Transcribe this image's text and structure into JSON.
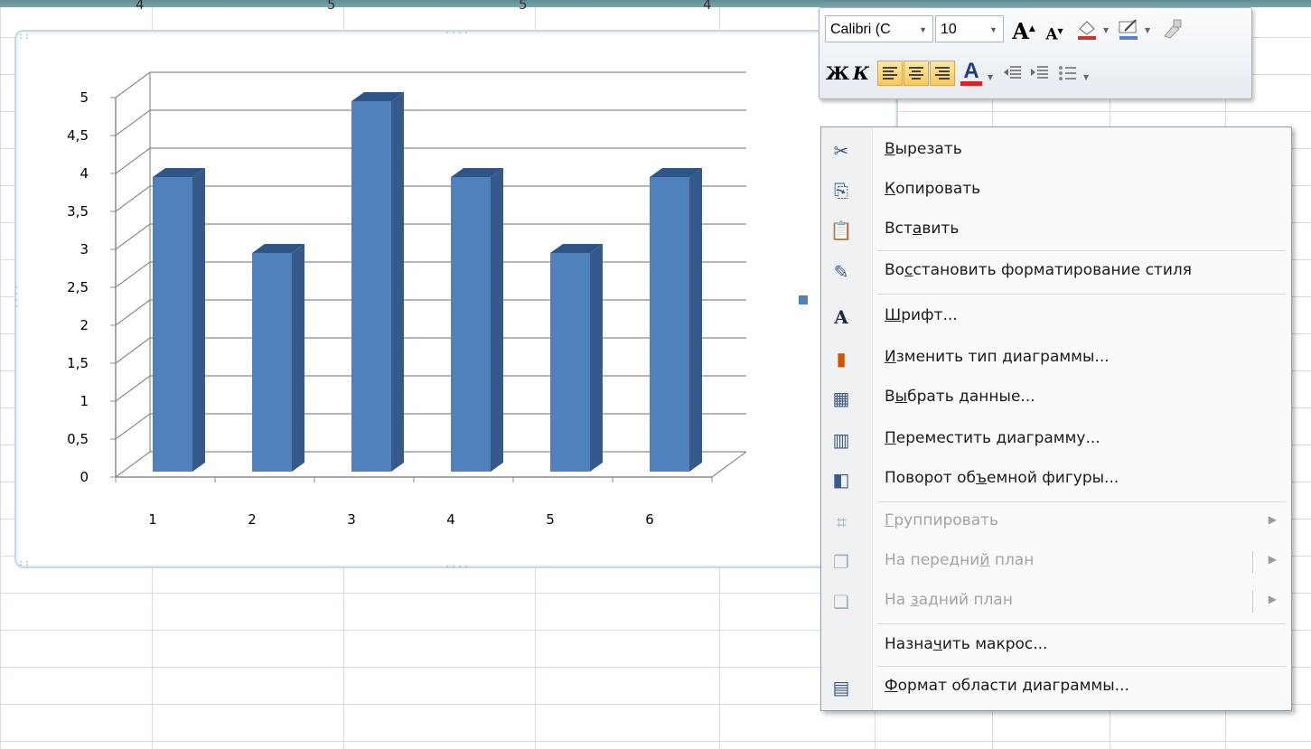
{
  "sheet": {
    "top_row_values": [
      "4",
      "5",
      "5",
      "4"
    ]
  },
  "chart": {
    "legend_marker_color": "#4f81bd"
  },
  "chart_data": {
    "type": "bar",
    "style": "3d-column",
    "categories": [
      "1",
      "2",
      "3",
      "4",
      "5",
      "6"
    ],
    "series": [
      {
        "values": [
          4,
          3,
          5,
          4,
          3,
          4
        ],
        "color": "#4f81bd"
      }
    ],
    "ylim": [
      0,
      5
    ],
    "yticks": [
      "0",
      "0,5",
      "1",
      "1,5",
      "2",
      "2,5",
      "3",
      "3,5",
      "4",
      "4,5",
      "5"
    ],
    "grid": true,
    "title": "",
    "xlabel": "",
    "ylabel": ""
  },
  "mini_toolbar": {
    "font_name": "Calibri (С",
    "font_size": "10",
    "grow_font": "A",
    "shrink_font": "A",
    "bold": "Ж",
    "italic": "К",
    "font_color_letter": "A",
    "font_color_bar": "#e02020",
    "highlight_color_bar": "#5a7fc4",
    "fill_color_bar": "#c0392b"
  },
  "context_menu": {
    "items": [
      {
        "icon": "scissors-icon",
        "pre": "",
        "u": "В",
        "post": "ырезать",
        "disabled": false
      },
      {
        "icon": "copy-icon",
        "pre": "",
        "u": "К",
        "post": "опировать",
        "disabled": false
      },
      {
        "icon": "paste-icon",
        "pre": "Вст",
        "u": "а",
        "post": "вить",
        "disabled": false
      },
      {
        "icon": "reset-style-icon",
        "pre": "Во",
        "u": "с",
        "post": "становить форматирование стиля",
        "disabled": false
      },
      {
        "icon": "font-icon",
        "pre": "",
        "u": "Ш",
        "post": "рифт...",
        "disabled": false
      },
      {
        "icon": "chart-type-icon",
        "pre": "",
        "u": "И",
        "post": "зменить тип диаграммы...",
        "disabled": false
      },
      {
        "icon": "select-data-icon",
        "pre": "В",
        "u": "ы",
        "post": "брать данные...",
        "disabled": false
      },
      {
        "icon": "move-chart-icon",
        "pre": "",
        "u": "П",
        "post": "ереместить диаграмму...",
        "disabled": false
      },
      {
        "icon": "3d-rotation-icon",
        "pre": "Поворот об",
        "u": "ъ",
        "post": "емной фигуры...",
        "disabled": false
      },
      {
        "icon": "group-icon",
        "pre": "",
        "u": "Г",
        "post": "руппировать",
        "disabled": true
      },
      {
        "icon": "bring-forward-icon",
        "pre": "На передни",
        "u": "й",
        "post": " план",
        "disabled": true
      },
      {
        "icon": "send-backward-icon",
        "pre": "На ",
        "u": "з",
        "post": "адний план",
        "disabled": true
      },
      {
        "icon": "",
        "pre": "Назна",
        "u": "ч",
        "post": "ить макрос...",
        "disabled": false
      },
      {
        "icon": "format-chart-area-icon",
        "pre": "",
        "u": "Ф",
        "post": "ормат области диаграммы...",
        "disabled": false
      }
    ]
  }
}
